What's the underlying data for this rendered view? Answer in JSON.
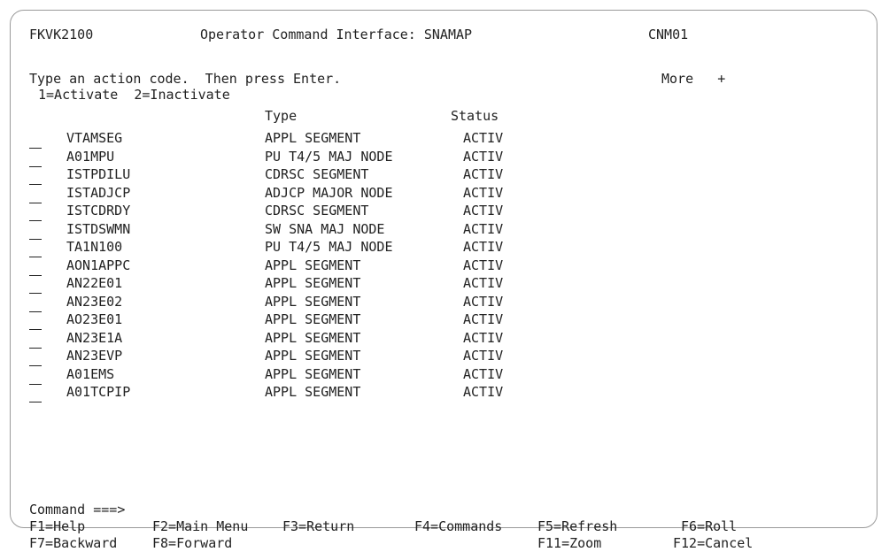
{
  "header": {
    "panel_id": "FKVK2100",
    "title": "Operator Command Interface: SNAMAP",
    "system": "CNM01"
  },
  "instructions": {
    "line1": "Type an action code.  Then press Enter.",
    "more": "More   +",
    "actions": "1=Activate  2=Inactivate"
  },
  "table": {
    "headers": {
      "type": "Type",
      "status": "Status"
    },
    "selection_placeholder": "_",
    "rows": [
      {
        "name": "VTAMSEG",
        "type": "APPL SEGMENT",
        "status": "ACTIV"
      },
      {
        "name": "A01MPU",
        "type": "PU T4/5 MAJ NODE",
        "status": "ACTIV"
      },
      {
        "name": "ISTPDILU",
        "type": "CDRSC SEGMENT",
        "status": "ACTIV"
      },
      {
        "name": "ISTADJCP",
        "type": "ADJCP MAJOR NODE",
        "status": "ACTIV"
      },
      {
        "name": "ISTCDRDY",
        "type": "CDRSC SEGMENT",
        "status": "ACTIV"
      },
      {
        "name": "ISTDSWMN",
        "type": "SW SNA MAJ NODE",
        "status": "ACTIV"
      },
      {
        "name": "TA1N100",
        "type": "PU T4/5 MAJ NODE",
        "status": "ACTIV"
      },
      {
        "name": "AON1APPC",
        "type": "APPL SEGMENT",
        "status": "ACTIV"
      },
      {
        "name": "AN22E01",
        "type": "APPL SEGMENT",
        "status": "ACTIV"
      },
      {
        "name": "AN23E02",
        "type": "APPL SEGMENT",
        "status": "ACTIV"
      },
      {
        "name": "AO23E01",
        "type": "APPL SEGMENT",
        "status": "ACTIV"
      },
      {
        "name": "AN23E1A",
        "type": "APPL SEGMENT",
        "status": "ACTIV"
      },
      {
        "name": "AN23EVP",
        "type": "APPL SEGMENT",
        "status": "ACTIV"
      },
      {
        "name": "A01EMS",
        "type": "APPL SEGMENT",
        "status": "ACTIV"
      },
      {
        "name": "A01TCPIP",
        "type": "APPL SEGMENT",
        "status": "ACTIV"
      }
    ]
  },
  "command": {
    "label": "Command ===>",
    "value": ""
  },
  "fkeys": {
    "row1": [
      "F1=Help",
      "F2=Main Menu",
      "F3=Return",
      "F4=Commands",
      "F5=Refresh",
      "F6=Roll"
    ],
    "row2": [
      "F7=Backward",
      "F8=Forward",
      "F11=Zoom",
      "F12=Cancel"
    ]
  }
}
